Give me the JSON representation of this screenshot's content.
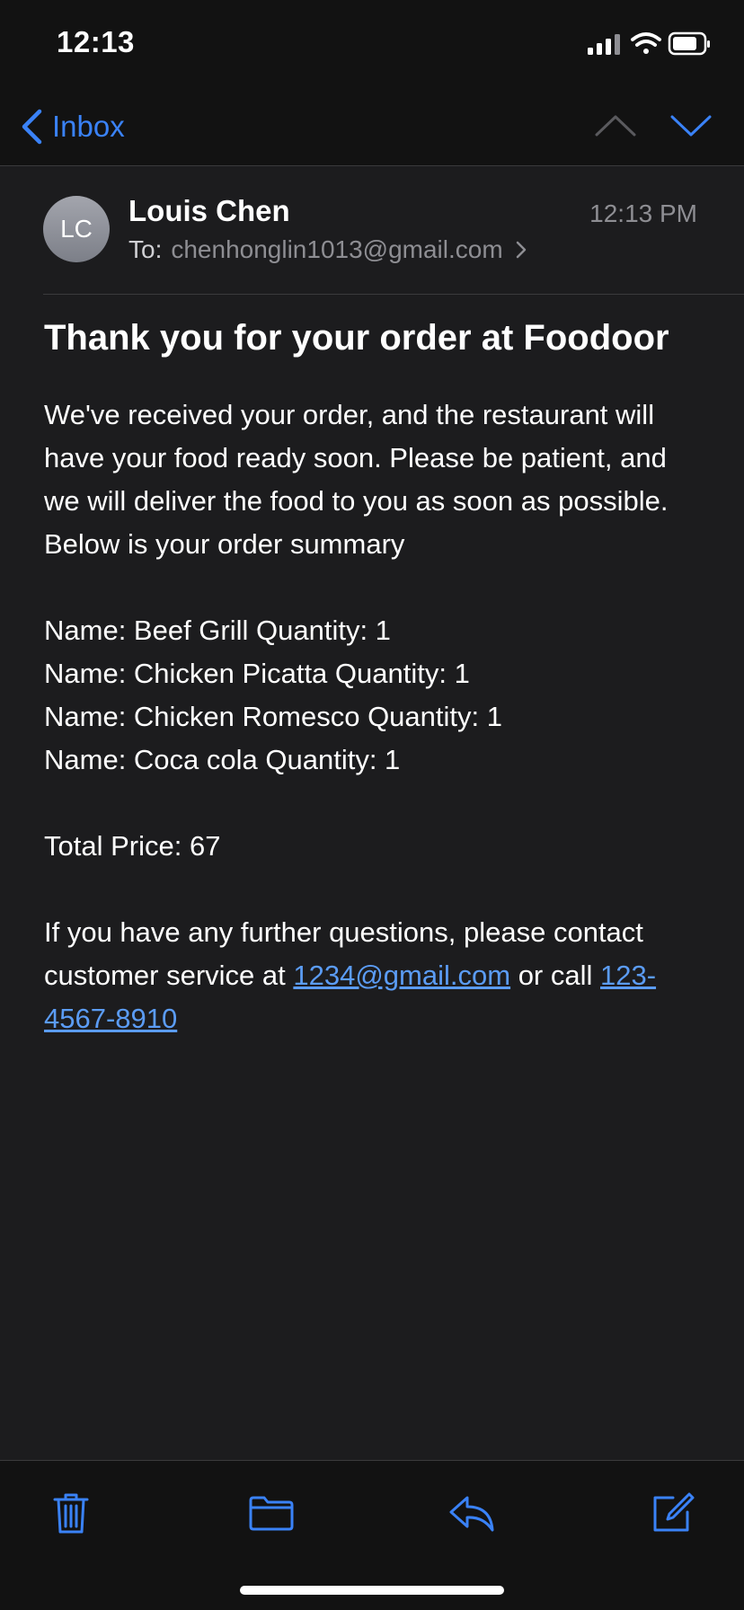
{
  "status_bar": {
    "time": "12:13"
  },
  "nav": {
    "back_label": "Inbox",
    "icons": [
      "chevron-left-icon",
      "chevron-up-icon",
      "chevron-down-icon"
    ]
  },
  "email": {
    "avatar_initials": "LC",
    "sender_name": "Louis Chen",
    "to_label": "To:",
    "recipient": "chenhonglin1013@gmail.com",
    "time": "12:13 PM",
    "subject": "Thank you for your order at Foodoor",
    "intro": "We've received your order, and the restaurant will have your food ready soon. Please be patient, and we will deliver the food to you as soon as possible. Below is your order summary",
    "items": [
      "Name: Beef Grill Quantity: 1",
      "Name: Chicken Picatta Quantity: 1",
      "Name: Chicken Romesco Quantity: 1",
      "Name: Coca cola Quantity: 1"
    ],
    "total": "Total Price: 67",
    "contact_prefix": "If you have any further questions, please contact customer service at ",
    "contact_email": "1234@gmail.com",
    "contact_mid": " or call ",
    "contact_phone": "123-4567-8910"
  },
  "toolbar": {
    "icons": [
      "trash-icon",
      "folder-icon",
      "reply-icon",
      "compose-icon"
    ]
  },
  "colors": {
    "accent": "#3a82f7",
    "link": "#5b9cf5",
    "background": "#1c1c1e",
    "bar_background": "#121212",
    "secondary_text": "#8e8e93"
  }
}
